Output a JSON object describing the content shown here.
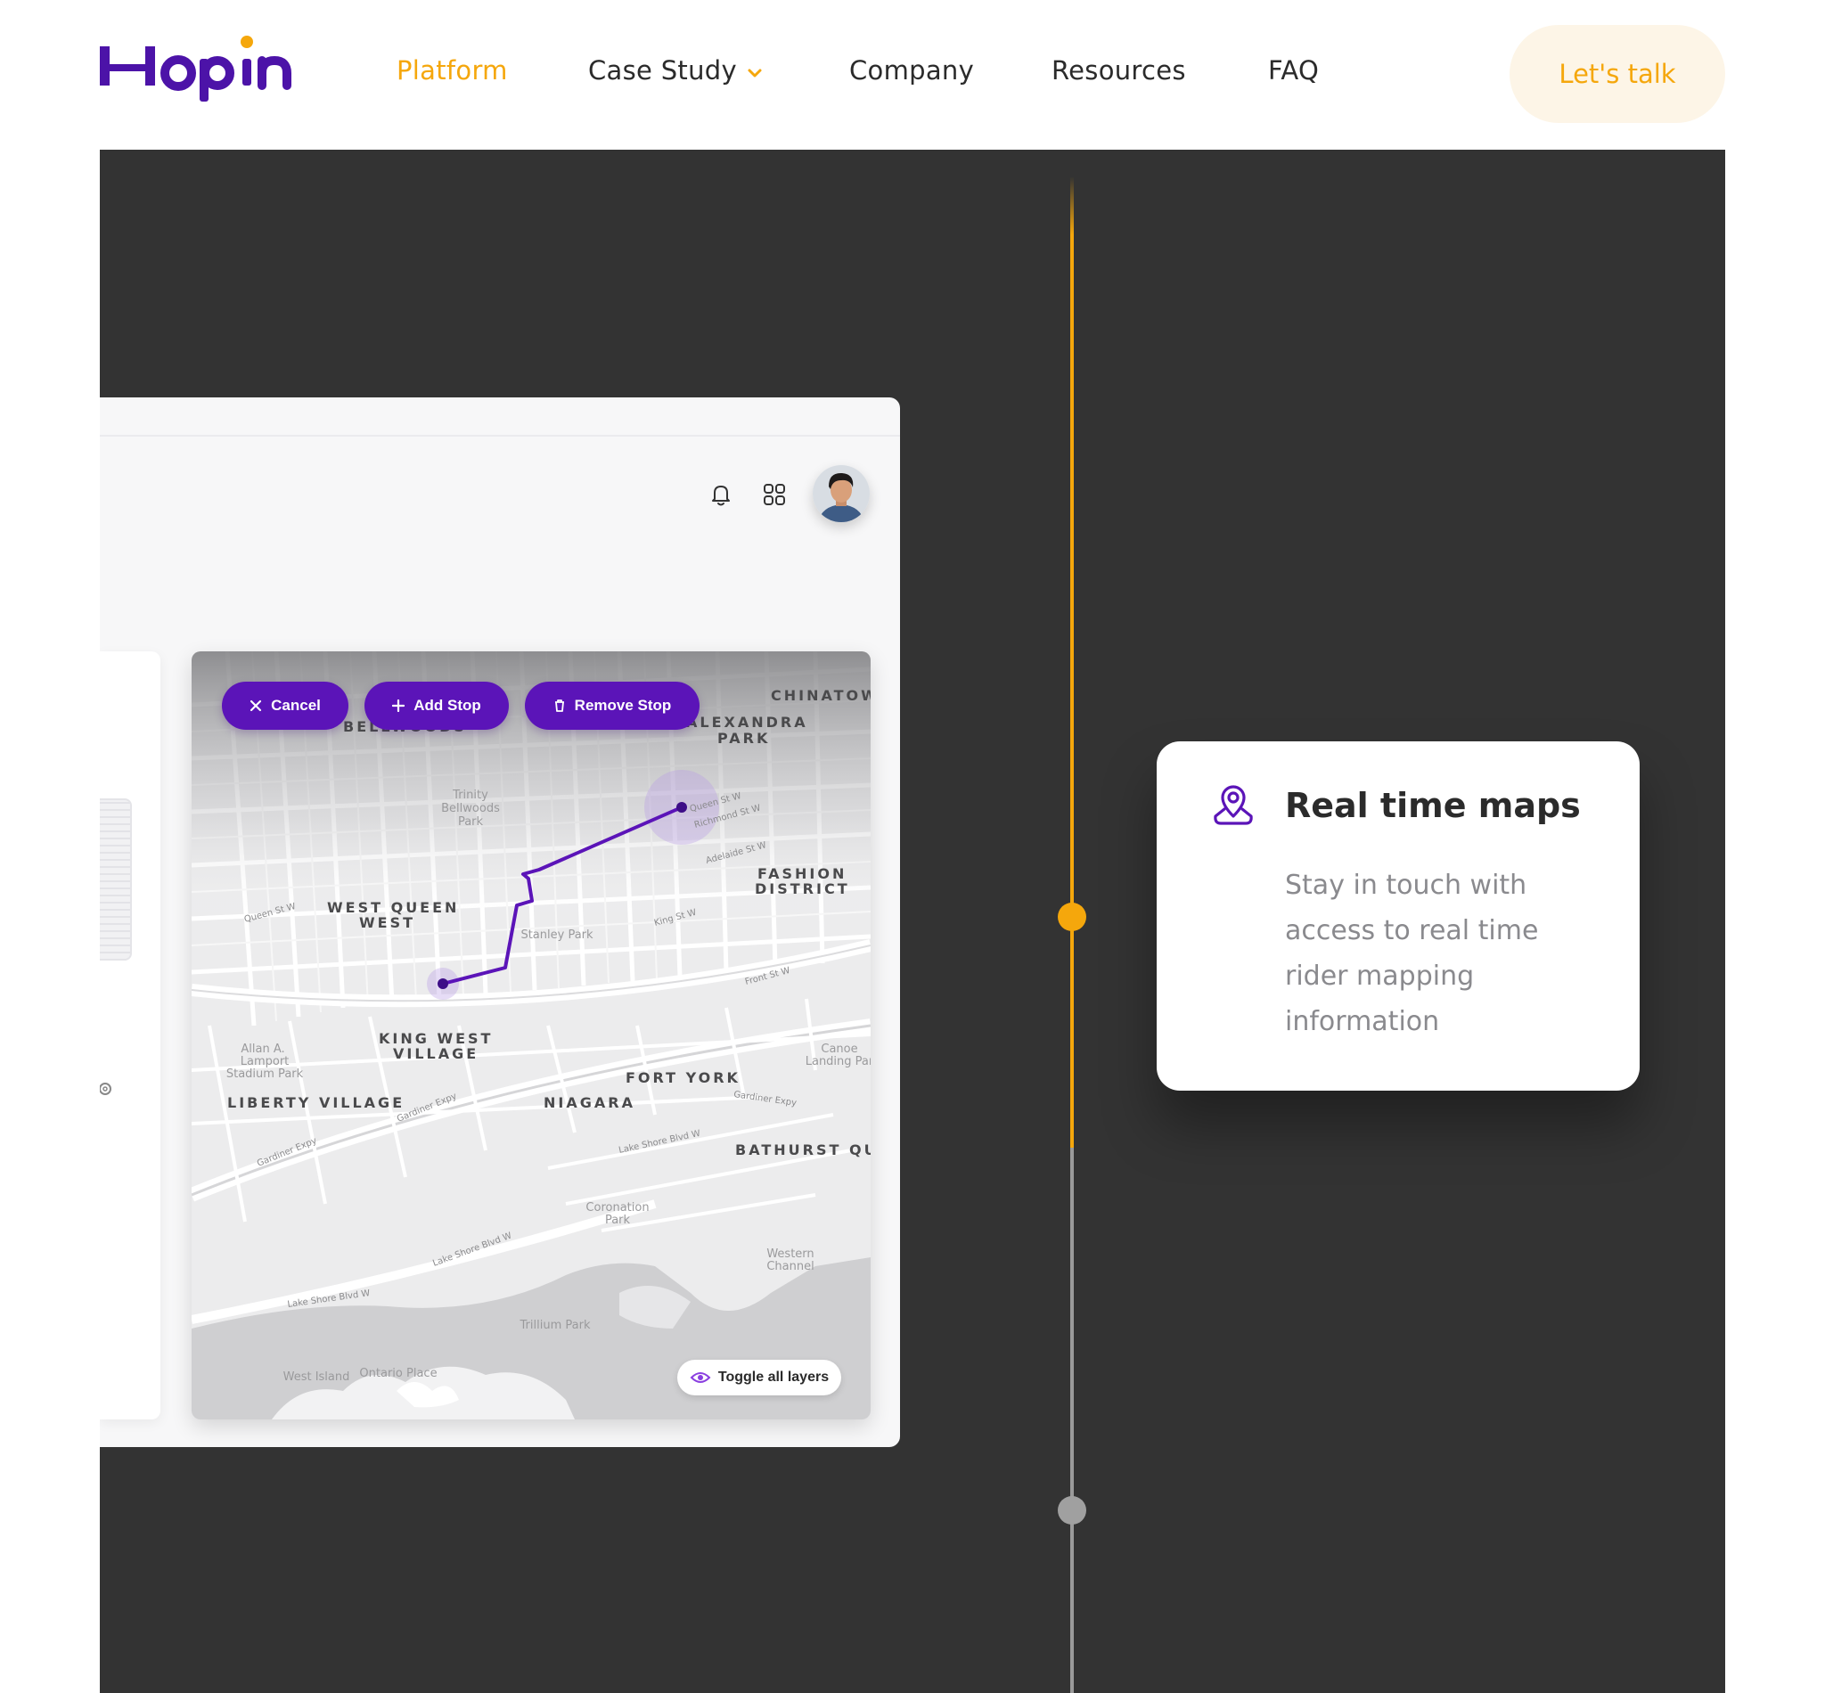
{
  "brand": {
    "name": "Hopin",
    "primary_color": "#4c13a8",
    "accent_color": "#f5a70c"
  },
  "nav": {
    "items": [
      {
        "label": "Platform",
        "active": true
      },
      {
        "label": "Case Study",
        "has_dropdown": true
      },
      {
        "label": "Company"
      },
      {
        "label": "Resources"
      },
      {
        "label": "FAQ"
      }
    ],
    "cta_label": "Let's talk"
  },
  "app": {
    "header_icons": [
      "bell-icon",
      "grid-icon"
    ],
    "map": {
      "buttons": [
        {
          "label": "Cancel",
          "icon": "close-icon"
        },
        {
          "label": "Add Stop",
          "icon": "plus-icon"
        },
        {
          "label": "Remove Stop",
          "icon": "trash-icon"
        }
      ],
      "toggle_label": "Toggle all layers",
      "route_color": "#5b14b8",
      "labels": {
        "chinatown": "CHINATOW",
        "alexandra": "ALEXANDRA",
        "park": "PARK",
        "bellwoods": "BELLWOODS",
        "trinity": "Trinity",
        "trinity2": "Bellwoods",
        "trinity3": "Park",
        "fashion": "FASHION",
        "district": "DISTRICT",
        "wq1": "WEST QUEEN",
        "wq2": "WEST",
        "stanley": "Stanley Park",
        "kw1": "KING WEST",
        "kw2": "VILLAGE",
        "liberty": "LIBERTY VILLAGE",
        "niagara": "NIAGARA",
        "fortyork": "FORT YORK",
        "bathurst": "BATHURST QU/",
        "allan1": "Allan A.",
        "allan2": "Lamport",
        "allan3": "Stadium Park",
        "canoe1": "Canoe",
        "canoe2": "Landing Par",
        "coron1": "Coronation",
        "coron2": "Park",
        "western1": "Western",
        "western2": "Channel",
        "trillium": "Trillium Park",
        "westisland": "West Island",
        "ontario": "Ontario Place",
        "queen": "Queen St W",
        "richmond": "Richmond St W",
        "adelaide": "Adelaide St W",
        "king": "King St W",
        "front": "Front St W",
        "gardiner1": "Gardiner Expy",
        "gardiner2": "Gardiner Expy",
        "gardiner3": "Gardiner Expy",
        "lakeshore1": "Lake Shore Blvd W",
        "lakeshore2": "Lake Shore Blvd W",
        "lakeshore3": "Lake Shore Blvd W",
        "queen2": "Queen St W"
      }
    }
  },
  "feature": {
    "icon": "map-pin-icon",
    "title": "Real time maps",
    "description": "Stay in touch with access to real time rider mapping information"
  }
}
